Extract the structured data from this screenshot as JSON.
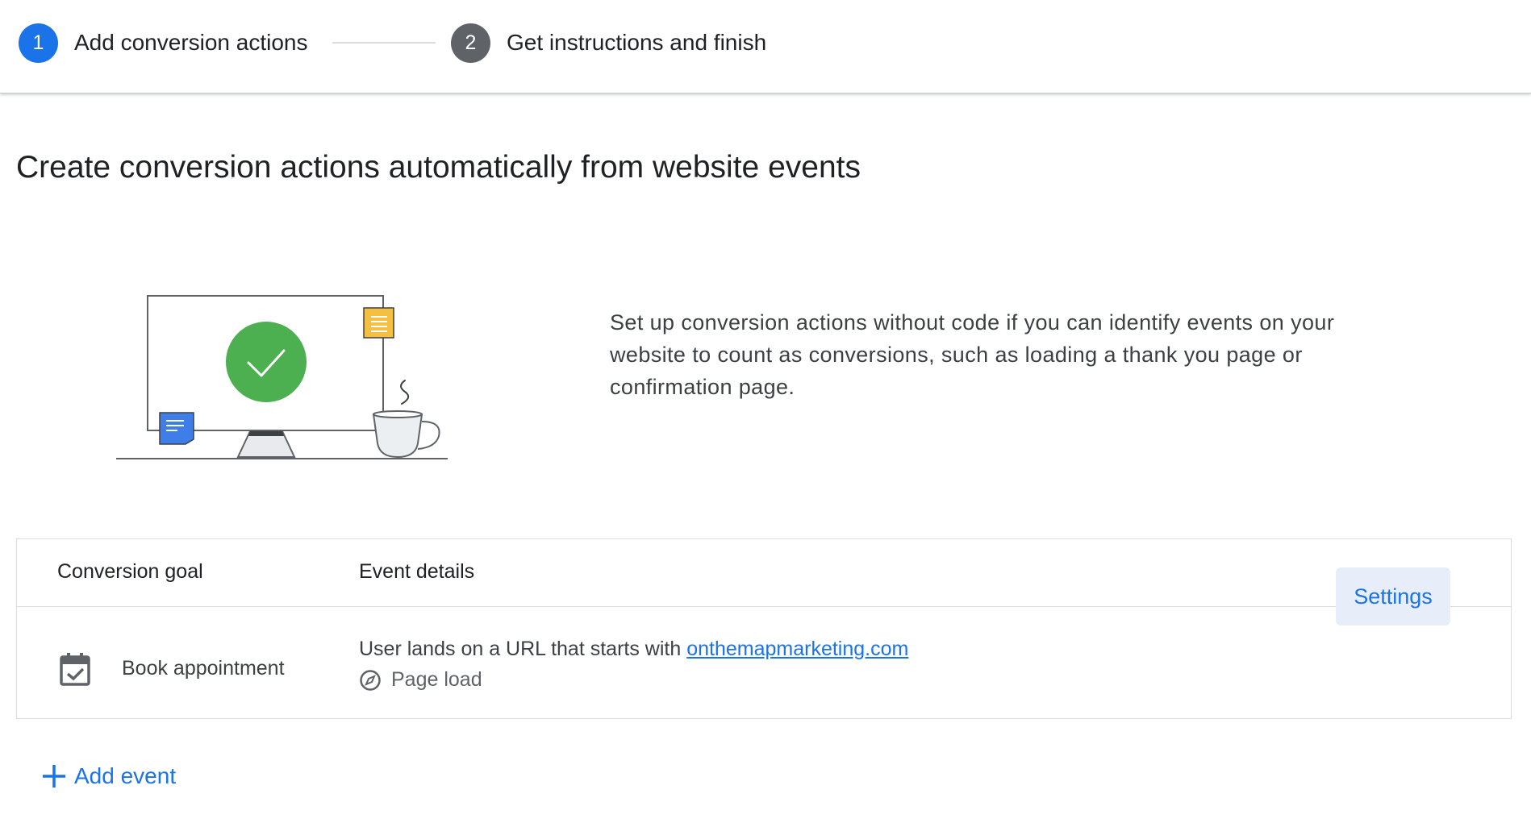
{
  "stepper": {
    "steps": [
      {
        "number": "1",
        "label": "Add conversion actions",
        "state": "active"
      },
      {
        "number": "2",
        "label": "Get instructions and finish",
        "state": "inactive"
      }
    ]
  },
  "page": {
    "title": "Create conversion actions automatically from website events",
    "description": "Set up conversion actions without code if you can identify events on your website to count as conversions, such as loading a thank you page or confirmation page."
  },
  "table": {
    "headers": {
      "goal": "Conversion goal",
      "details": "Event details"
    },
    "rows": [
      {
        "goal_icon": "calendar-check-icon",
        "goal": "Book appointment",
        "condition_prefix": "User lands on a URL that starts with ",
        "condition_link": "onthemapmarketing.com",
        "event_type_icon": "compass-icon",
        "event_type": "Page load",
        "settings_label": "Settings"
      }
    ]
  },
  "actions": {
    "add_event_icon": "plus-icon",
    "add_event_label": "Add event"
  },
  "colors": {
    "accent": "#1a73e8",
    "inactive_step": "#5f6368",
    "success_green": "#4caf50",
    "note_yellow": "#f5c042",
    "note_blue": "#3f7ee8",
    "button_bg": "#e8eef9"
  }
}
